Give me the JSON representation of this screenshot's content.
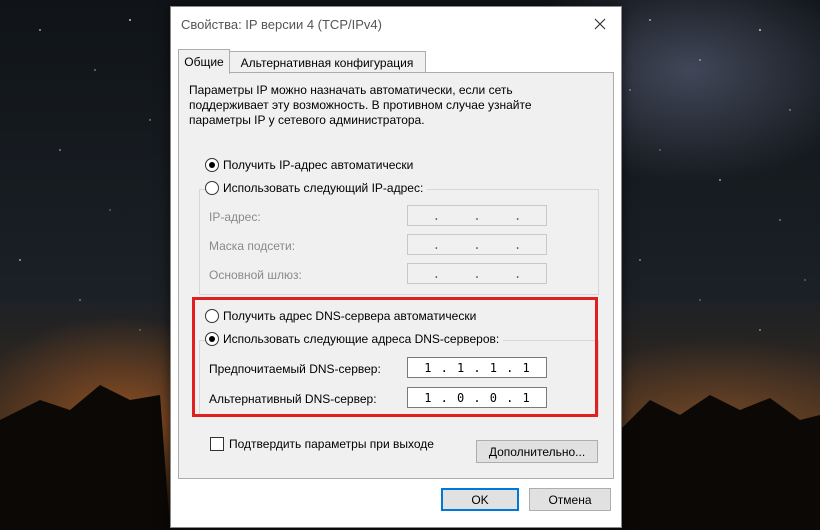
{
  "window": {
    "title": "Свойства: IP версии 4 (TCP/IPv4)"
  },
  "tabs": [
    {
      "label": "Общие",
      "active": true
    },
    {
      "label": "Альтернативная конфигурация",
      "active": false
    }
  ],
  "general": {
    "description_lines": [
      "Параметры IP можно назначать автоматически, если сеть",
      "поддерживает эту возможность. В противном случае узнайте",
      "параметры IP у сетевого администратора."
    ],
    "ip_auto_label": "Получить IP-адрес автоматически",
    "ip_manual_label": "Использовать следующий IP-адрес:",
    "ip_mode": "auto",
    "ip_address_label": "IP-адрес:",
    "subnet_label": "Маска подсети:",
    "gateway_label": "Основной шлюз:",
    "dns_auto_label": "Получить адрес DNS-сервера автоматически",
    "dns_manual_label": "Использовать следующие адреса DNS-серверов:",
    "dns_mode": "manual",
    "preferred_dns_label": "Предпочитаемый DNS-сервер:",
    "preferred_dns": [
      "1",
      "1",
      "1",
      "1"
    ],
    "alternate_dns_label": "Альтернативный DNS-сервер:",
    "alternate_dns": [
      "1",
      "0",
      "0",
      "1"
    ],
    "validate_on_exit_label": "Подтвердить параметры при выходе",
    "validate_on_exit": false,
    "advanced_button": "Дополнительно..."
  },
  "footer": {
    "ok_label": "OK",
    "cancel_label": "Отмена"
  },
  "colors": {
    "highlight_box": "#e02020",
    "default_button_border": "#0078d7"
  }
}
